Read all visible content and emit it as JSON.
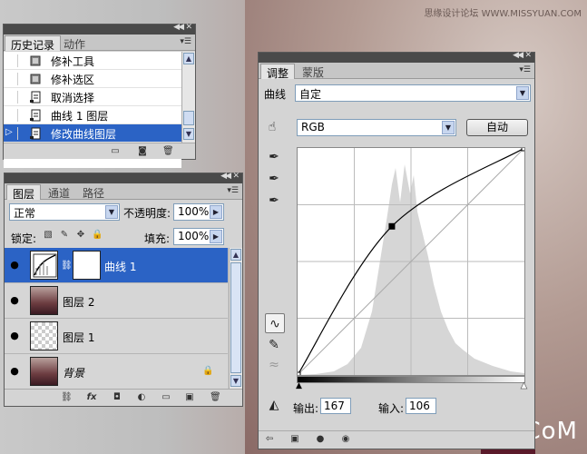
{
  "watermark": {
    "top": "思缘设计论坛 WWW.MISSYUAN.COM",
    "bottom": "UiBQ.CoM"
  },
  "history_panel": {
    "tabs": [
      "历史记录",
      "动作"
    ],
    "items": [
      {
        "label": "修补工具",
        "icon": "patch-tool-icon",
        "selected": false
      },
      {
        "label": "修补选区",
        "icon": "patch-tool-icon",
        "selected": false
      },
      {
        "label": "取消选择",
        "icon": "document-step-icon",
        "selected": false
      },
      {
        "label": "曲线 1 图层",
        "icon": "document-step-icon",
        "selected": false
      },
      {
        "label": "修改曲线图层",
        "icon": "document-step-icon",
        "selected": true
      }
    ]
  },
  "layers_panel": {
    "tabs": [
      "图层",
      "通道",
      "路径"
    ],
    "blend_mode": "正常",
    "opacity_label": "不透明度:",
    "opacity_value": "100%",
    "lock_label": "锁定:",
    "fill_label": "填充:",
    "fill_value": "100%",
    "layers": [
      {
        "name": "曲线 1",
        "type": "adjustment",
        "selected": true
      },
      {
        "name": "图层 2",
        "type": "photo",
        "selected": false
      },
      {
        "name": "图层 1",
        "type": "transparent",
        "selected": false
      },
      {
        "name": "背景",
        "type": "photo",
        "selected": false,
        "italic": true,
        "locked": true
      }
    ]
  },
  "adjust_panel": {
    "tabs": [
      "调整",
      "蒙版"
    ],
    "preset_label": "曲线",
    "preset_value": "自定",
    "channel": "RGB",
    "auto_button": "自动",
    "output_label": "输出:",
    "output_value": "167",
    "input_label": "输入:",
    "input_value": "106"
  },
  "chart_data": {
    "type": "line",
    "series": [
      {
        "x": [
          0,
          106,
          255
        ],
        "y": [
          0,
          167,
          255
        ]
      }
    ],
    "xlim": [
      0,
      255
    ],
    "ylim": [
      0,
      255
    ],
    "grid": true
  }
}
